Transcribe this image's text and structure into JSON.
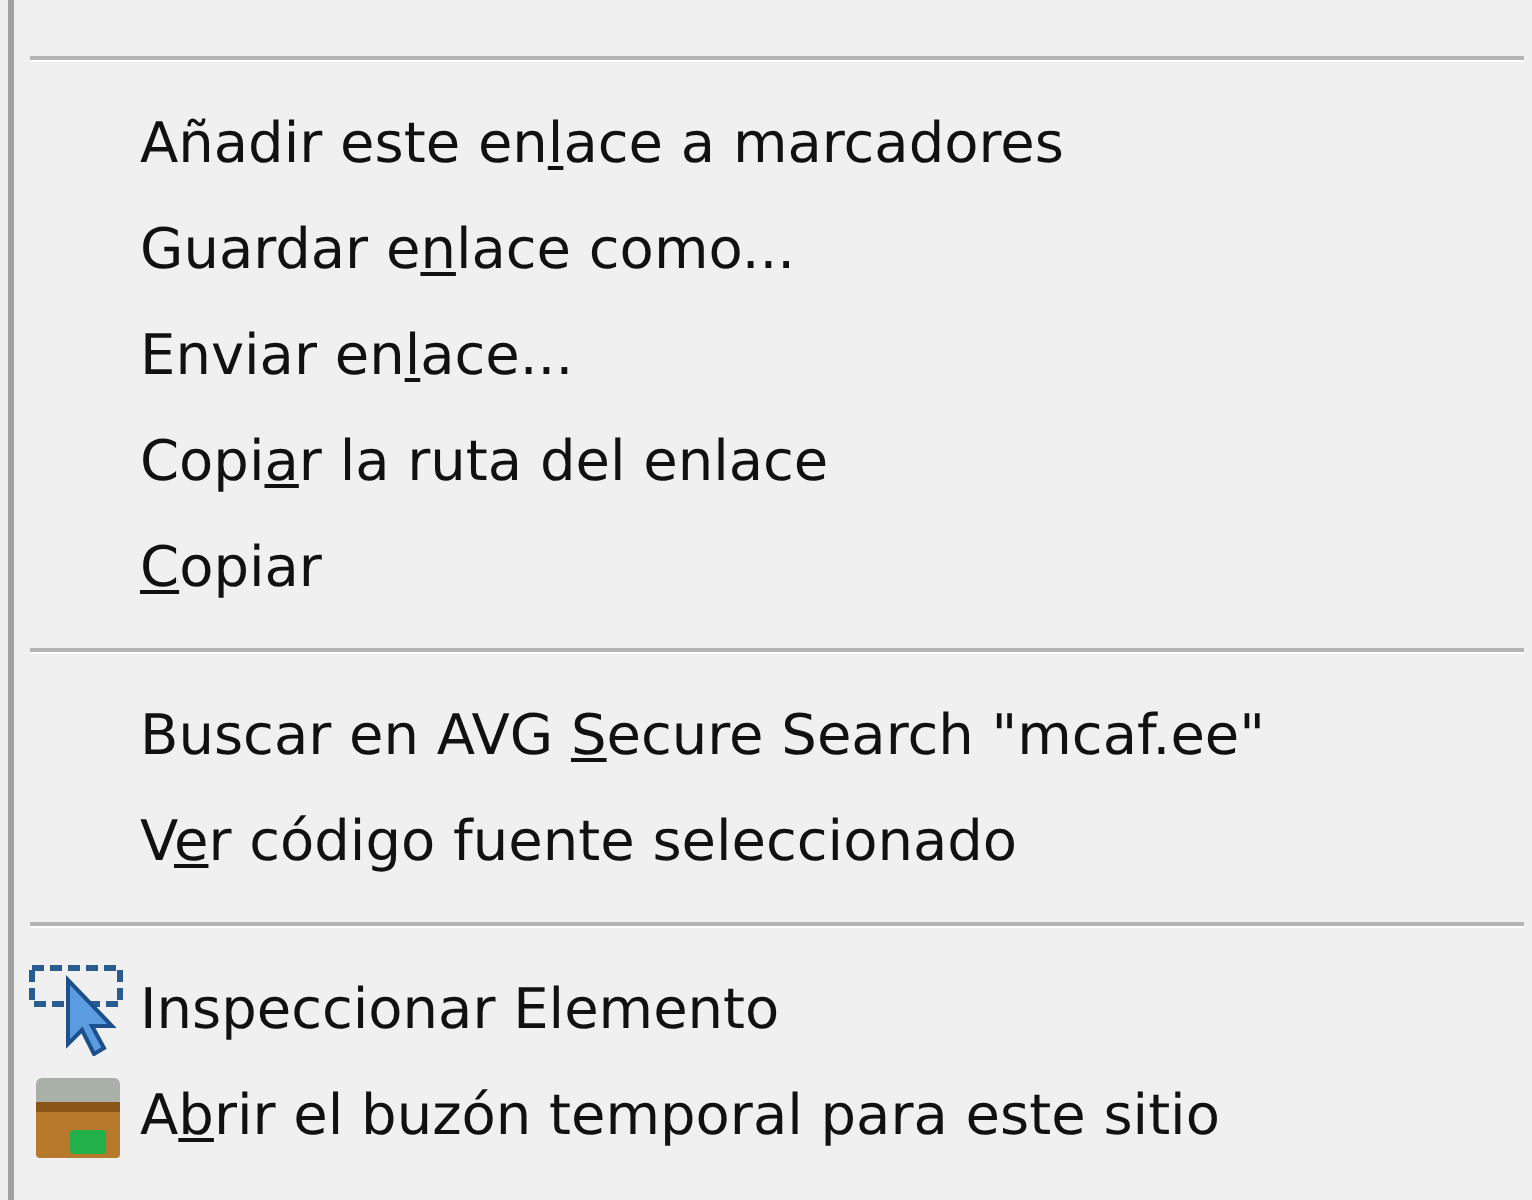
{
  "menu": {
    "groups": [
      {
        "items": [
          {
            "kind": "text",
            "before": "Añadir este en",
            "key": "l",
            "after": "ace a marcadores"
          },
          {
            "kind": "text",
            "before": "Guardar e",
            "key": "n",
            "after": "lace como..."
          },
          {
            "kind": "text",
            "before": "Enviar en",
            "key": "l",
            "after": "ace..."
          },
          {
            "kind": "text",
            "before": "Copi",
            "key": "a",
            "after": "r la ruta del enlace"
          },
          {
            "kind": "text",
            "key": "C",
            "after": "opiar"
          }
        ]
      },
      {
        "items": [
          {
            "kind": "text",
            "before": "Buscar en AVG ",
            "key": "S",
            "after": "ecure Search \"mcaf.ee\""
          },
          {
            "kind": "text",
            "before": "V",
            "key": "e",
            "after": "r código fuente seleccionado"
          }
        ]
      },
      {
        "items": [
          {
            "kind": "inspect",
            "before": "Inspeccionar Elemento"
          },
          {
            "kind": "mailbox",
            "before": "A",
            "key": "b",
            "after": "rir el buzón temporal para este sitio"
          }
        ]
      }
    ]
  }
}
